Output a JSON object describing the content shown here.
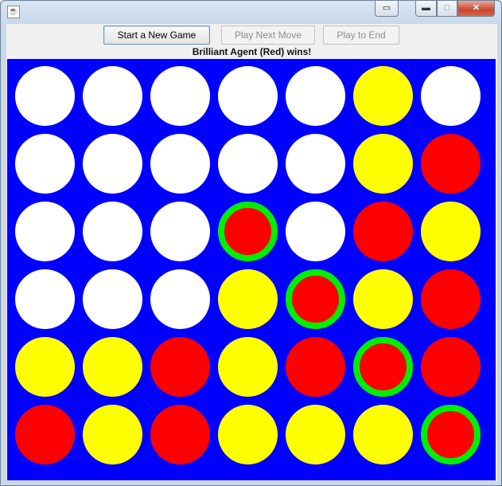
{
  "window": {
    "title": "",
    "icon": "java-cup-icon",
    "controls": {
      "extra": "▭",
      "minimize": "▬",
      "maximize": "□",
      "close": "✕"
    }
  },
  "toolbar": {
    "new_game_label": "Start a New Game",
    "next_move_label": "Play Next Move",
    "play_to_end_label": "Play to End"
  },
  "status": "Brilliant Agent (Red) wins!",
  "colors": {
    "board": "#0000ff",
    "empty": "#ffffff",
    "red": "#ff0000",
    "yellow": "#ffff00",
    "win_ring": "#00ee00"
  },
  "board": {
    "rows": 6,
    "cols": 7,
    "cells": [
      [
        "empty",
        "empty",
        "empty",
        "empty",
        "empty",
        "yellow",
        "empty"
      ],
      [
        "empty",
        "empty",
        "empty",
        "empty",
        "empty",
        "yellow",
        "red"
      ],
      [
        "empty",
        "empty",
        "empty",
        "red",
        "empty",
        "red",
        "yellow"
      ],
      [
        "empty",
        "empty",
        "empty",
        "yellow",
        "red",
        "yellow",
        "red"
      ],
      [
        "yellow",
        "yellow",
        "red",
        "yellow",
        "red",
        "red",
        "red"
      ],
      [
        "red",
        "yellow",
        "red",
        "yellow",
        "yellow",
        "yellow",
        "red"
      ]
    ],
    "winning_cells": [
      [
        2,
        3
      ],
      [
        3,
        4
      ],
      [
        4,
        5
      ],
      [
        5,
        6
      ]
    ]
  }
}
